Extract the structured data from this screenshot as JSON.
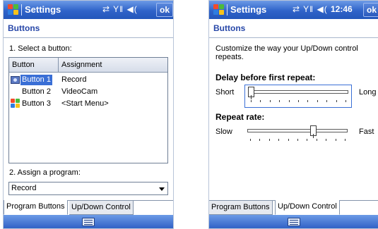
{
  "left_screen": {
    "title": "Settings",
    "status_icons": "⇄ Y‖ ◀(",
    "ok_label": "ok",
    "heading": "Buttons",
    "step1_label": "1. Select a button:",
    "list": {
      "columns": [
        "Button",
        "Assignment"
      ],
      "rows": [
        {
          "button": "Button 1",
          "assignment": "Record",
          "icon": "record-icon",
          "selected": true
        },
        {
          "button": "Button 2",
          "assignment": "VideoCam",
          "icon": "",
          "selected": false
        },
        {
          "button": "Button 3",
          "assignment": "<Start Menu>",
          "icon": "windows-flag-icon",
          "selected": false
        }
      ]
    },
    "step2_label": "2. Assign a program:",
    "program_value": "Record",
    "tabs": [
      "Program Buttons",
      "Up/Down Control"
    ],
    "active_tab": 0
  },
  "right_screen": {
    "title": "Settings",
    "status_icons": "⇄ Y‖ ◀(",
    "time": "12:46",
    "ok_label": "ok",
    "heading": "Buttons",
    "description": "Customize the way your Up/Down control repeats.",
    "delay_label": "Delay before first repeat:",
    "delay_min": "Short",
    "delay_max": "Long",
    "delay_value": 0.0,
    "rate_label": "Repeat rate:",
    "rate_min": "Slow",
    "rate_max": "Fast",
    "rate_value": 0.67,
    "tabs": [
      "Program Buttons",
      "Up/Down Control"
    ],
    "active_tab": 1
  },
  "colors": {
    "title_bar": "#2f63c9",
    "heading_text": "#2747a8",
    "selection": "#3a6fd6"
  }
}
